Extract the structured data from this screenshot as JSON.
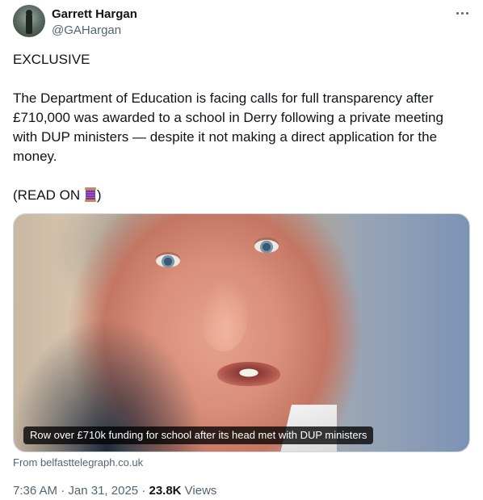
{
  "author": {
    "name": "Garrett Hargan",
    "handle": "@GAHargan"
  },
  "menu": {
    "icon": "more-horizontal-icon"
  },
  "tweet": {
    "line1": "EXCLUSIVE",
    "line2": "The Department of Education is facing calls for full transparency after £710,000 was awarded to a school in Derry following a private meeting with DUP ministers — despite it not making a direct application for the money.",
    "read_on_prefix": "(READ ON ",
    "read_on_icon": "thread-spool-emoji",
    "read_on_suffix": ")"
  },
  "card": {
    "caption": "Row over £710k funding for school after its head met with DUP ministers",
    "source": "From belfasttelegraph.co.uk"
  },
  "meta": {
    "time": "7:36 AM",
    "sep1": " · ",
    "date": "Jan 31, 2025",
    "sep2": " · ",
    "views_count": "23.8K",
    "views_label": " Views"
  }
}
